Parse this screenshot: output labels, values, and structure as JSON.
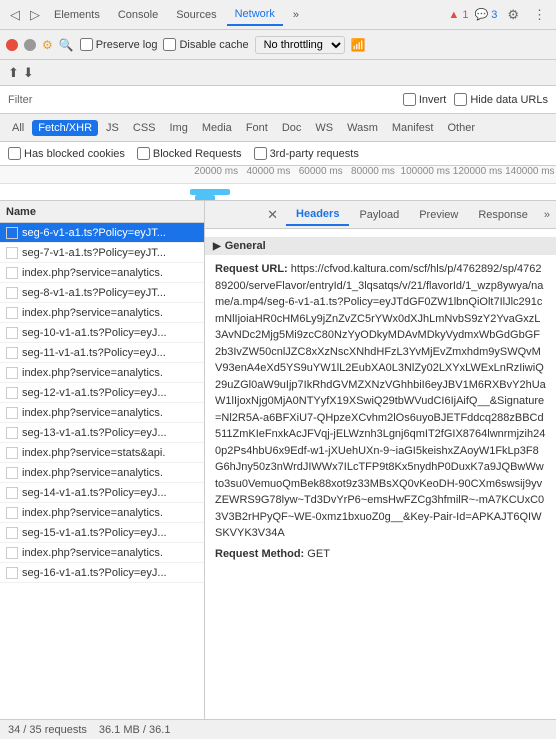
{
  "tabs": {
    "elements": "Elements",
    "console": "Console",
    "sources": "Sources",
    "network": "Network",
    "more": "»"
  },
  "toolbar_icons": {
    "count1": "1",
    "count2": "3",
    "settings": "⚙",
    "more": "⋮"
  },
  "network_toolbar": {
    "preserve_log": "Preserve log",
    "disable_cache": "Disable cache",
    "throttling": "No throttling"
  },
  "filter_bar": {
    "label": "Filter",
    "invert": "Invert",
    "hide_urls": "Hide data URLs"
  },
  "type_filters": [
    "All",
    "Fetch/XHR",
    "JS",
    "CSS",
    "Img",
    "Media",
    "Font",
    "Doc",
    "WS",
    "Wasm",
    "Manifest",
    "Other"
  ],
  "active_type": "Fetch/XHR",
  "blocked_bar": {
    "has_blocked": "Has blocked cookies",
    "blocked_req": "Blocked Requests",
    "third_party": "3rd-party requests"
  },
  "timeline": {
    "labels": [
      "20000 ms",
      "40000 ms",
      "60000 ms",
      "80000 ms",
      "100000 ms",
      "120000 ms",
      "140000 ms"
    ]
  },
  "requests": [
    {
      "name": "seg-6-v1-a1.ts?Policy=eyJT...",
      "selected": true
    },
    {
      "name": "seg-7-v1-a1.ts?Policy=eyJT...",
      "selected": false
    },
    {
      "name": "index.php?service=analytics.",
      "selected": false
    },
    {
      "name": "seg-8-v1-a1.ts?Policy=eyJT...",
      "selected": false
    },
    {
      "name": "index.php?service=analytics.",
      "selected": false
    },
    {
      "name": "seg-10-v1-a1.ts?Policy=eyJ...",
      "selected": false
    },
    {
      "name": "seg-11-v1-a1.ts?Policy=eyJ...",
      "selected": false
    },
    {
      "name": "index.php?service=analytics.",
      "selected": false
    },
    {
      "name": "seg-12-v1-a1.ts?Policy=eyJ...",
      "selected": false
    },
    {
      "name": "index.php?service=analytics.",
      "selected": false
    },
    {
      "name": "seg-13-v1-a1.ts?Policy=eyJ...",
      "selected": false
    },
    {
      "name": "index.php?service=stats&api.",
      "selected": false
    },
    {
      "name": "index.php?service=analytics.",
      "selected": false
    },
    {
      "name": "seg-14-v1-a1.ts?Policy=eyJ...",
      "selected": false
    },
    {
      "name": "index.php?service=analytics.",
      "selected": false
    },
    {
      "name": "seg-15-v1-a1.ts?Policy=eyJ...",
      "selected": false
    },
    {
      "name": "index.php?service=analytics.",
      "selected": false
    },
    {
      "name": "seg-16-v1-a1.ts?Policy=eyJ...",
      "selected": false
    }
  ],
  "detail": {
    "tabs": [
      "Headers",
      "Payload",
      "Preview",
      "Response"
    ],
    "active_tab": "Headers",
    "section_title": "General",
    "request_url_label": "Request URL:",
    "request_url_value": "https://cfvod.kaltura.com/scf/hls/p/4762892/sp/476289200/serveFlavor/entryId/1_3lqsatqs/v/21/flavorId/1_wzp8ywya/name/a.mp4/seg-6-v1-a1.ts?Policy=eyJTdGF0ZW1lbnQiOlt7IlJlc291cmNlIjoiaHR0cHM6Ly9jZnZvZC5rYWx0dXJhLmNvbS9zY2YvaGxzL3AvNDc2Mjg5Mi9zcC80NzYyODkyMDAvMDkyVydmxWbGdGbGF2b3IvZW50cnlJZC8xXzNscXNhdHFzL3YvMjEvZmxhdm9ySWQvMV93enA4eXd5YS9uYW1lL2EubXA0L3NlZy02LXYxLWExLnRzIiwiQ29uZGl0aW9uIjp7IkRhdGVMZXNzVGhhbiI6eyJBV1M6RXBvY2hUaW1lIjoxNjg0MjA0NTYyfX19XSwiQ29tbWVudCI6IjAifQ__&Signature=Nl2R5A-a6BFXiU7-QHpzeXCvhm2lOs6uyoBJETFddcq288zBBCd511ZmKIeFnxkAcJFVqj-jELWznh3Lgnj6qmIT2fGIX8764lwnrmjzih240p2Ps4hbU6x9Edf-w1-jXUehUXn-9~iaGI5keishxZAoyW1FkLp3F8G6hJny50z3nWrdJIWWx7ILcTFP9t8Kx5nydhP0DuxK7a9JQBwWwto3su0VemuoQmBek88xot9z33MBsXQ0vKeoDH-90CXm6swsij9yvZEWRS9G78lyw~Td3DvYrP6~emsHwFZCg3hfmilR~-mA7KCUxC03V3B2rHPyQF~WE-0xmz1bxuoZ0g__&Key-Pair-Id=APKAJT6QIWSKVYK3V34A",
    "method_label": "Request Method:",
    "method_value": "GET"
  },
  "status_bar": {
    "requests": "34 / 35 requests",
    "size": "36.1 MB / 36.1"
  }
}
